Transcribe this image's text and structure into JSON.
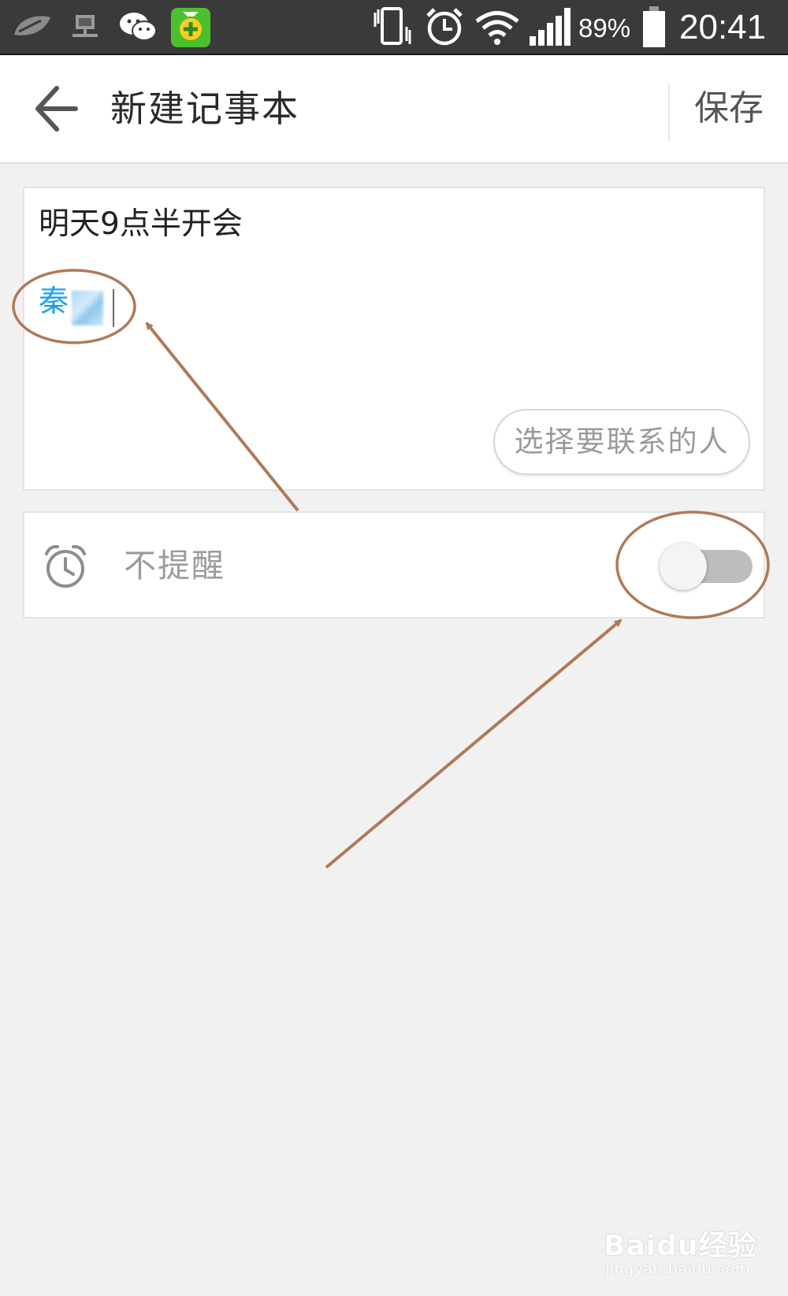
{
  "status_bar": {
    "battery": "89%",
    "time": "20:41",
    "icons": [
      "leaf-icon",
      "network-icon",
      "wechat-icon",
      "security-app-icon",
      "vibrate-icon",
      "alarm-icon",
      "wifi-icon",
      "signal-icon",
      "battery-icon"
    ]
  },
  "header": {
    "title": "新建记事本",
    "save_label": "保存"
  },
  "note": {
    "text": "明天9点半开会",
    "contact_name": "秦",
    "choose_contact_label": "选择要联系的人"
  },
  "reminder": {
    "label": "不提醒",
    "enabled": false
  },
  "watermark": {
    "brand": "Baidu经验",
    "url": "jingyan.baidu.com"
  },
  "colors": {
    "accent": "#1da1e8",
    "annotation": "#b07a58",
    "background": "#f1f1f1"
  }
}
